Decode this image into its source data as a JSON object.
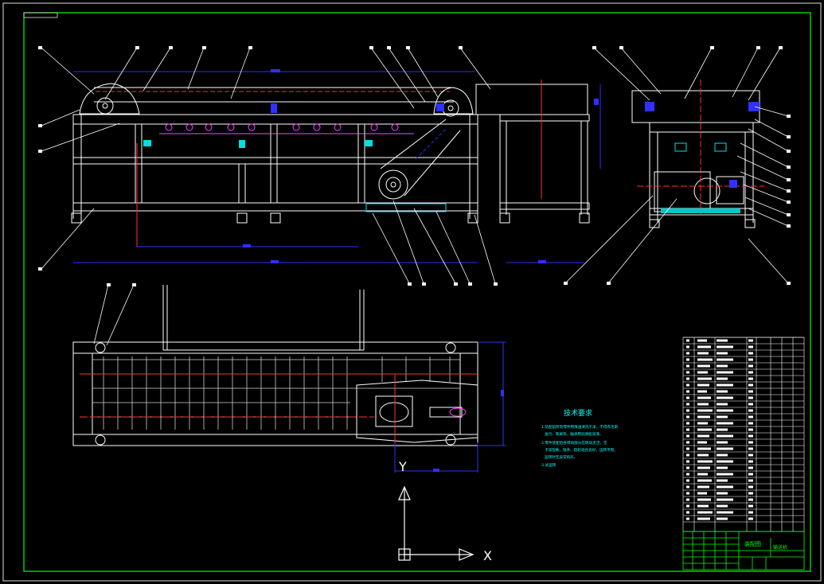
{
  "drawing": {
    "tech_title": "技术要求",
    "tech_notes": [
      "1.装配前所有零件用煤油清洗干净，不得有毛刺",
      "油污、铁屑等，轴承用润滑脂润滑。",
      "2.零件装配后各转动部分应转动灵活，无",
      "卡滞现象，链条、链轮啮合良好，运转平稳。",
      "运转时无异常响声。",
      "3.试运转"
    ],
    "axis_y": "Y",
    "axis_x": "X",
    "title_block_name": "装配图",
    "title_block_product": "输送机"
  },
  "colors": {
    "background": "#000000",
    "frame": "#00ff00",
    "line": "#ffffff",
    "center": "#ff2020",
    "dimension": "#0000ff",
    "accent_cyan": "#00ffff",
    "accent_magenta": "#ff00ff",
    "accent_yellow": "#ffff00"
  }
}
